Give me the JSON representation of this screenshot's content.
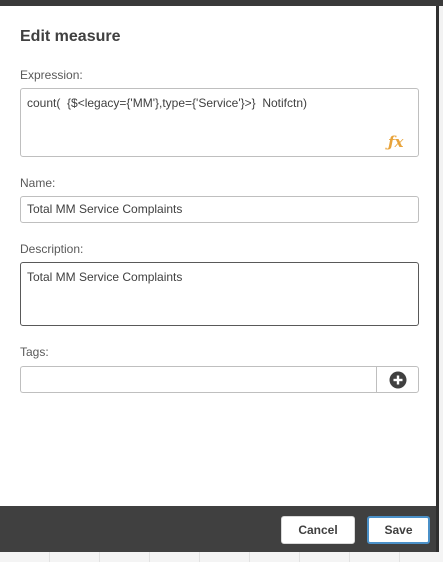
{
  "dialog": {
    "title": "Edit measure",
    "expression": {
      "label": "Expression:",
      "value": "count(  {$<legacy={'MM'},type={'Service'}>}  Notifctn)",
      "fx_icon": "fx-expression-editor-icon",
      "fx_color": "#e8a33a"
    },
    "name": {
      "label": "Name:",
      "value": "Total MM Service Complaints"
    },
    "description": {
      "label": "Description:",
      "value": "Total MM Service Complaints"
    },
    "tags": {
      "label": "Tags:",
      "value": "",
      "add_icon": "plus-circle-icon"
    },
    "footer": {
      "cancel_label": "Cancel",
      "save_label": "Save",
      "save_border_color": "#4a90c8"
    }
  }
}
